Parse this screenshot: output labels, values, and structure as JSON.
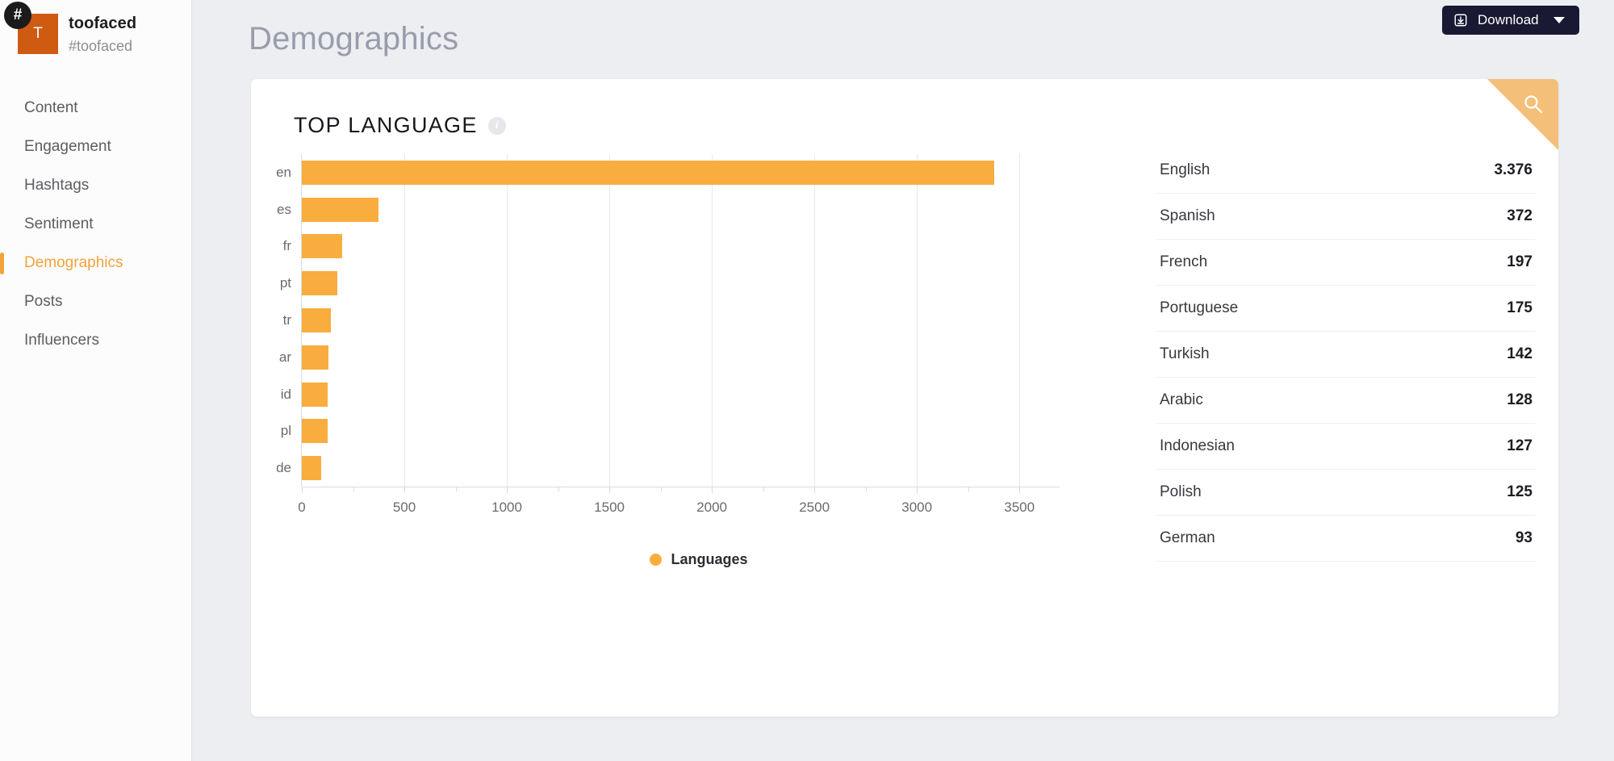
{
  "sidebar": {
    "avatar_initial": "T",
    "badge_icon": "hashtag-icon",
    "account_name": "toofaced",
    "account_handle": "#toofaced",
    "items": [
      {
        "label": "Content",
        "active": false
      },
      {
        "label": "Engagement",
        "active": false
      },
      {
        "label": "Hashtags",
        "active": false
      },
      {
        "label": "Sentiment",
        "active": false
      },
      {
        "label": "Demographics",
        "active": true
      },
      {
        "label": "Posts",
        "active": false
      },
      {
        "label": "Influencers",
        "active": false
      }
    ]
  },
  "header": {
    "title": "Demographics",
    "download_label": "Download",
    "download_icon": "download-icon",
    "caret_icon": "chevron-down-icon"
  },
  "card": {
    "title": "TOP LANGUAGE",
    "info_icon": "info-icon",
    "info_glyph": "i",
    "search_icon": "search-icon"
  },
  "colors": {
    "bar": "#f9ad3e",
    "accent": "#f2a33c",
    "avatar": "#cf5a11",
    "button": "#191933",
    "page_bg": "#eceef2",
    "corner": "#f4bf78"
  },
  "chart_data": {
    "type": "bar",
    "orientation": "horizontal",
    "title": "TOP LANGUAGE",
    "xlabel": "",
    "ylabel": "",
    "xlim": [
      0,
      3700
    ],
    "xticks": [
      0,
      500,
      1000,
      1500,
      2000,
      2500,
      3000,
      3500
    ],
    "xtick_labels": [
      "0",
      "500",
      "1000",
      "1500",
      "2000",
      "2500",
      "3000",
      "3500"
    ],
    "grid": true,
    "legend": {
      "position": "bottom",
      "entries": [
        "Languages"
      ]
    },
    "categories": [
      "en",
      "es",
      "fr",
      "pt",
      "tr",
      "ar",
      "id",
      "pl",
      "de"
    ],
    "values": [
      3376,
      372,
      197,
      175,
      142,
      128,
      127,
      125,
      93
    ],
    "series": [
      {
        "name": "Languages",
        "color": "#f9ad3e",
        "values": [
          3376,
          372,
          197,
          175,
          142,
          128,
          127,
          125,
          93
        ]
      }
    ]
  },
  "language_table": {
    "rows": [
      {
        "name": "English",
        "value": "3.376"
      },
      {
        "name": "Spanish",
        "value": "372"
      },
      {
        "name": "French",
        "value": "197"
      },
      {
        "name": "Portuguese",
        "value": "175"
      },
      {
        "name": "Turkish",
        "value": "142"
      },
      {
        "name": "Arabic",
        "value": "128"
      },
      {
        "name": "Indonesian",
        "value": "127"
      },
      {
        "name": "Polish",
        "value": "125"
      },
      {
        "name": "German",
        "value": "93"
      }
    ]
  }
}
